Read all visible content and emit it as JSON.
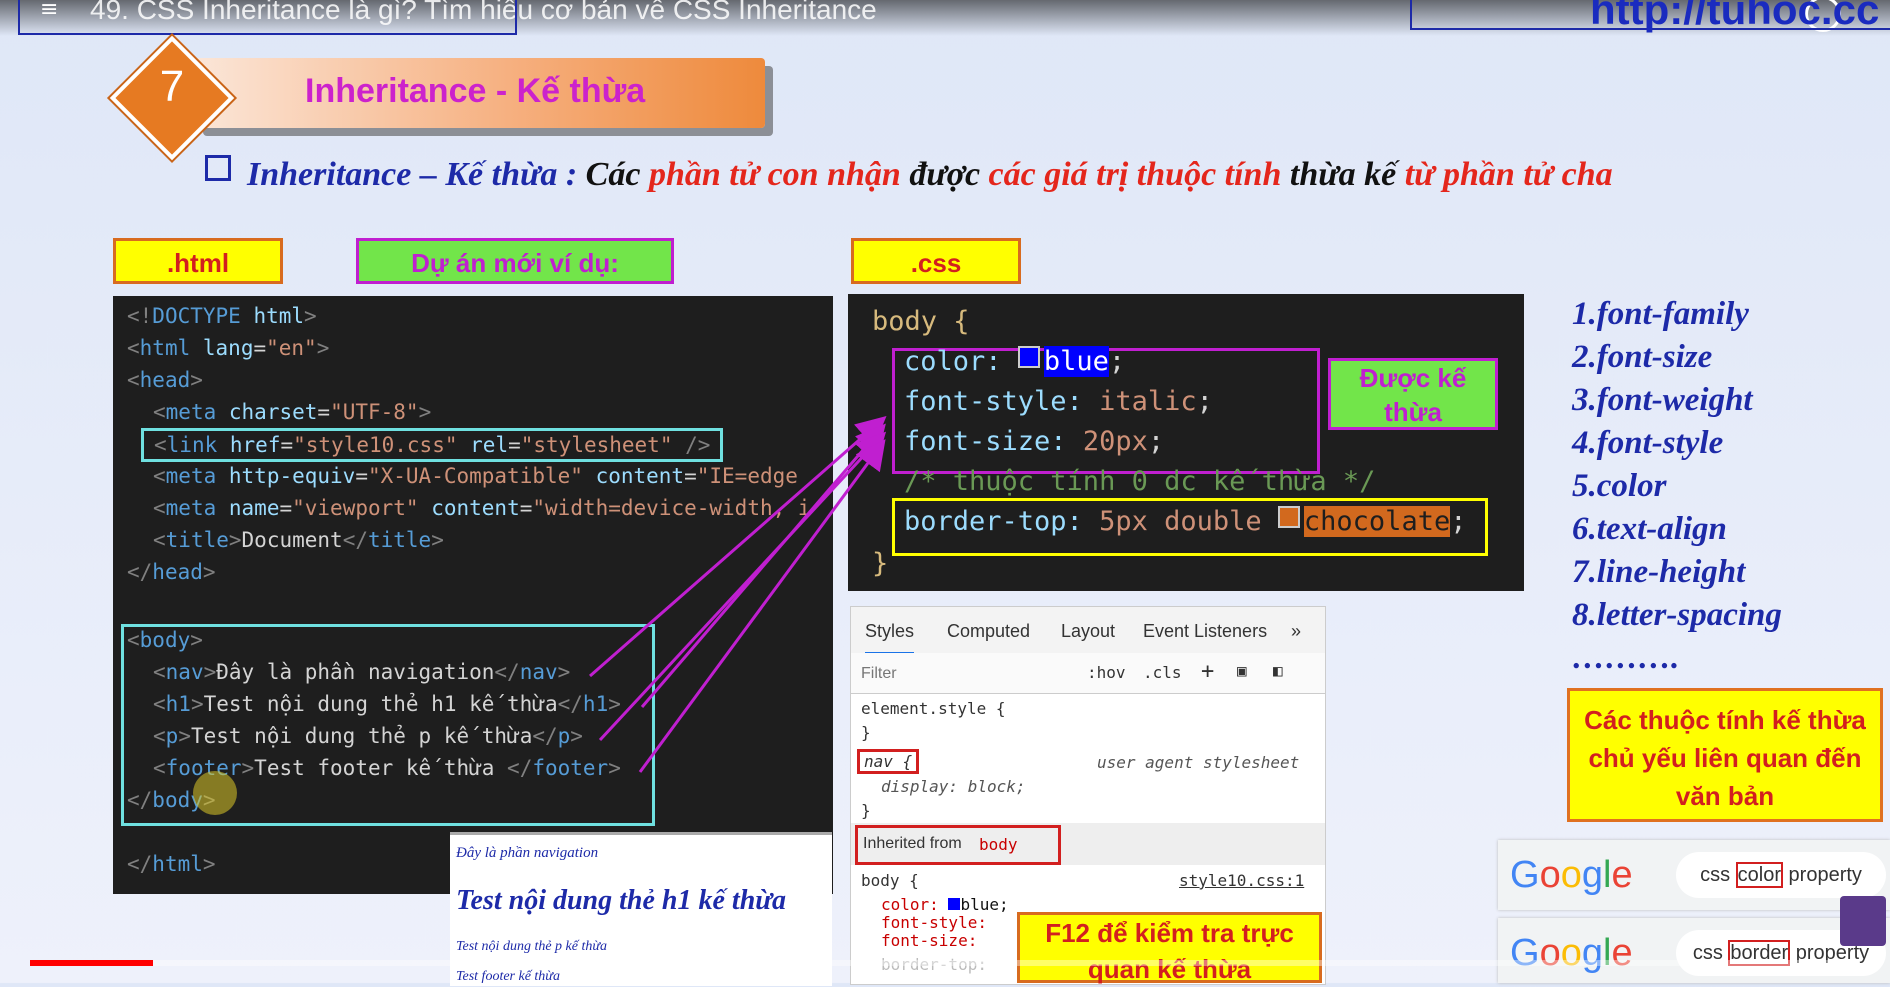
{
  "video": {
    "title": "49. CSS Inheritance là gì? Tìm hiểu cơ bản về CSS Inheritance",
    "site": "http://tuhoc.cc"
  },
  "heading": {
    "number": "7",
    "title": "Inheritance - Kế thừa"
  },
  "definition": {
    "part1": "Inheritance – Kế thừa : ",
    "part2": "Các ",
    "part3": "phần tử con nhận",
    "part4": " được ",
    "part5": "các giá trị thuộc tính",
    "part6": " thừa kế ",
    "part7": "từ phần tử cha"
  },
  "labels": {
    "html": ".html",
    "project": "Dự án mới ví dụ:",
    "css": ".css",
    "inherited": "Được kế thừa",
    "note": "Các thuộc tính kế thừa chủ yếu liên quan đến văn bản",
    "f12": "F12 để kiểm tra trực quan kế thừa"
  },
  "html_code": [
    "<!DOCTYPE html>",
    "<html lang=\"en\">",
    "<head>",
    "  <meta charset=\"UTF-8\">",
    "  <link href=\"style10.css\" rel=\"stylesheet\" />",
    "  <meta http-equiv=\"X-UA-Compatible\" content=\"IE=edge",
    "  <meta name=\"viewport\" content=\"width=device-width, i",
    "  <title>Document</title>",
    "</head>",
    "",
    "<body>",
    "  <nav>Đây là phần navigation</nav>",
    "  <h1>Test nội dung thẻ h1 kế thừa</h1>",
    "  <p>Test nội dung thẻ p kế thừa</p>",
    "  <footer>Test footer kế thừa </footer>",
    "</body>",
    "",
    "</html>"
  ],
  "css_code": {
    "selector": "body {",
    "color_prop": "color:",
    "color_val": "blue",
    "style_prop": "font-style:",
    "style_val": "italic",
    "size_prop": "font-size:",
    "size_val": "20px",
    "comment": "/* thuộc tính 0 dc kế thừa */",
    "border_prop": "border-top:",
    "border_val": "5px double",
    "border_color": "chocolate",
    "close": "}"
  },
  "devtools": {
    "tabs": [
      "Styles",
      "Computed",
      "Layout",
      "Event Listeners",
      "»"
    ],
    "filter_placeholder": "Filter",
    "hov": ":hov",
    ".cls": ".cls",
    "element_style": "element.style {",
    "brace_close": "}",
    "nav_rule": "nav {",
    "ua": "user agent stylesheet",
    "display": "display: block;",
    "inherited_from": "Inherited from",
    "inherited_tag": "body",
    "body_rule": "body {",
    "source": "style10.css:1",
    "color_line": "color:",
    "color_val": "blue;",
    "style_line": "font-style:",
    "size_line": "font-size:",
    "border_line": "border-top:"
  },
  "preview": {
    "nav": "Đây là phần navigation",
    "h1": "Test nội dung thẻ h1 kế thừa",
    "p": "Test nội dung thẻ p kế thừa",
    "footer": "Test footer kế thừa"
  },
  "properties": [
    "1.font-family",
    "2.font-size",
    "3.font-weight",
    "4.font-style",
    "5.color",
    "6.text-align",
    "7.line-height",
    "8.letter-spacing",
    "………."
  ],
  "google": [
    {
      "logo": "Google",
      "pre": "css ",
      "mid": "color",
      "post": " property"
    },
    {
      "logo": "Google",
      "pre": "css ",
      "mid": "border",
      "post": " property"
    }
  ],
  "colors": {
    "accent_red": "#e4261c",
    "accent_blue": "#1d2aa8",
    "arrow_magenta": "#c01fd0",
    "progress": "#ff0000"
  },
  "playback": {
    "progress": 0.067
  }
}
